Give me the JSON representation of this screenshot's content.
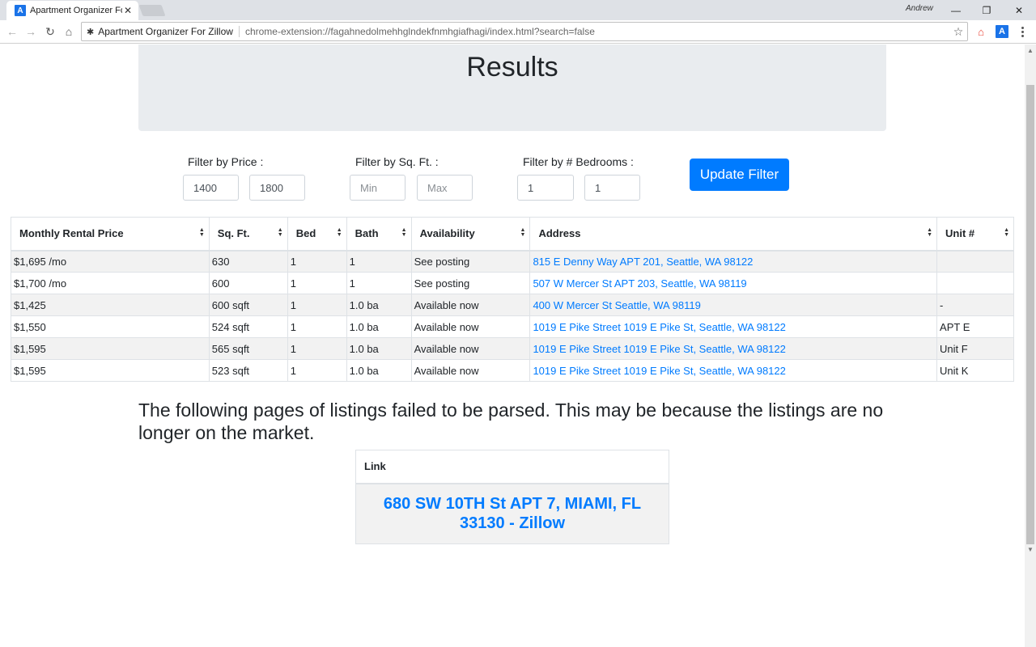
{
  "browser": {
    "tab_title": "Apartment Organizer For Zillow",
    "tab_icon_letter": "A",
    "user_name": "Andrew",
    "site_name": "Apartment Organizer For Zillow",
    "url": "chrome-extension://fagahnedolmehhglndekfnmhgiafhagi/index.html?search=false",
    "extension_letter": "A"
  },
  "page": {
    "title": "Results"
  },
  "filters": {
    "price_label": "Filter by Price :",
    "price_min": "1400",
    "price_max": "1800",
    "sqft_label": "Filter by Sq. Ft. :",
    "sqft_min_placeholder": "Min",
    "sqft_max_placeholder": "Max",
    "bedrooms_label": "Filter by # Bedrooms :",
    "bedrooms_min": "1",
    "bedrooms_max": "1",
    "update_button": "Update Filter"
  },
  "table": {
    "headers": [
      "Monthly Rental Price",
      "Sq. Ft.",
      "Bed",
      "Bath",
      "Availability",
      "Address",
      "Unit #"
    ],
    "rows": [
      {
        "price": "$1,695 /mo",
        "sqft": "630",
        "bed": "1",
        "bath": "1",
        "availability": "See posting",
        "address": "815 E Denny Way APT 201, Seattle, WA 98122",
        "unit": ""
      },
      {
        "price": "$1,700 /mo",
        "sqft": "600",
        "bed": "1",
        "bath": "1",
        "availability": "See posting",
        "address": "507 W Mercer St APT 203, Seattle, WA 98119",
        "unit": ""
      },
      {
        "price": "$1,425",
        "sqft": "600 sqft",
        "bed": "1",
        "bath": "1.0 ba",
        "availability": "Available now",
        "address": "400 W Mercer St Seattle, WA 98119",
        "unit": "-"
      },
      {
        "price": "$1,550",
        "sqft": "524 sqft",
        "bed": "1",
        "bath": "1.0 ba",
        "availability": "Available now",
        "address": "1019 E Pike Street 1019 E Pike St, Seattle, WA 98122",
        "unit": "APT E"
      },
      {
        "price": "$1,595",
        "sqft": "565 sqft",
        "bed": "1",
        "bath": "1.0 ba",
        "availability": "Available now",
        "address": "1019 E Pike Street 1019 E Pike St, Seattle, WA 98122",
        "unit": "Unit F"
      },
      {
        "price": "$1,595",
        "sqft": "523 sqft",
        "bed": "1",
        "bath": "1.0 ba",
        "availability": "Available now",
        "address": "1019 E Pike Street 1019 E Pike St, Seattle, WA 98122",
        "unit": "Unit K"
      }
    ]
  },
  "failed": {
    "message": "The following pages of listings failed to be parsed. This may be because the listings are no longer on the market.",
    "header": "Link",
    "links": [
      "680 SW 10TH St APT 7, MIAMI, FL 33130 - Zillow"
    ]
  },
  "colors": {
    "accent": "#007bff",
    "jumbotron": "#e9ecef",
    "stripe": "#f2f2f2"
  }
}
